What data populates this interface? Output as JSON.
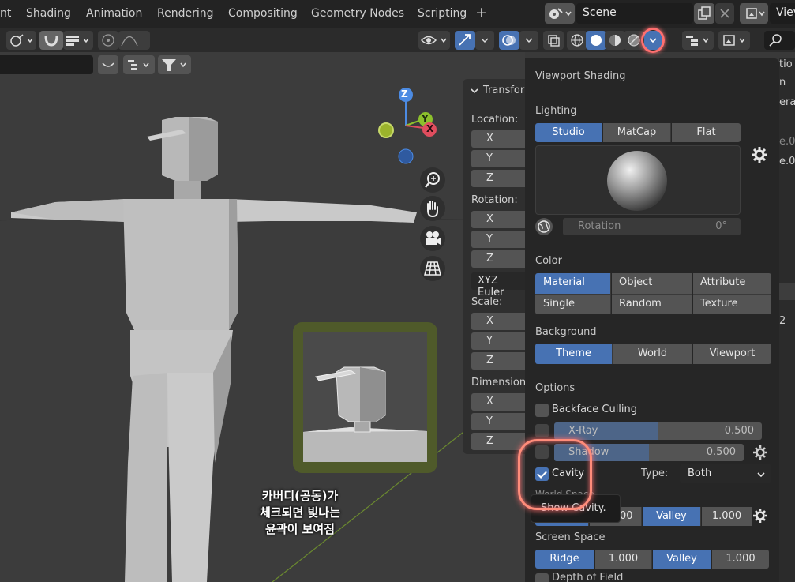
{
  "menubar": {
    "tabs": [
      "nt",
      "Shading",
      "Animation",
      "Rendering",
      "Compositing",
      "Geometry Nodes",
      "Scripting"
    ],
    "add_tab": "+",
    "scene_name": "Scene",
    "view_layer_label": "Viev"
  },
  "npanel": {
    "tab_title": "Transfor",
    "location_label": "Location:",
    "rotation_label": "Rotation:",
    "rotation_mode": "XYZ Euler",
    "scale_label": "Scale:",
    "dimensions_label": "Dimension",
    "axes": [
      "X",
      "Y",
      "Z"
    ]
  },
  "gizmo": {
    "z": "Z",
    "y": "Y",
    "x": "X"
  },
  "annotation": {
    "line1": "카버디(공동)가",
    "line2": "체크되면 빛나는",
    "line3": "윤곽이 보여짐"
  },
  "popover": {
    "title": "Viewport Shading",
    "lighting_label": "Lighting",
    "lighting_options": [
      "Studio",
      "MatCap",
      "Flat"
    ],
    "lighting_selected": "Studio",
    "rotation_label": "Rotation",
    "rotation_value": "0°",
    "color_label": "Color",
    "color_options": [
      "Material",
      "Object",
      "Attribute",
      "Single",
      "Random",
      "Texture"
    ],
    "color_selected": "Material",
    "background_label": "Background",
    "background_options": [
      "Theme",
      "World",
      "Viewport"
    ],
    "background_selected": "Theme",
    "options_label": "Options",
    "backface_culling": {
      "label": "Backface Culling",
      "checked": false
    },
    "xray": {
      "label": "X-Ray",
      "value": "0.500",
      "fraction": 0.5,
      "checked": false
    },
    "shadow": {
      "label": "Shadow",
      "value": "0.500",
      "fraction": 0.5,
      "checked": false
    },
    "cavity": {
      "label": "Cavity",
      "checked": true
    },
    "type_label": "Type:",
    "type_value": "Both",
    "world_space_label": "World Space",
    "tooltip": "Show Cavity.",
    "world_ridge_value": "00",
    "world_valley_label": "Valley",
    "world_valley_value": "1.000",
    "screen_space_label": "Screen Space",
    "screen_ridge_label": "Ridge",
    "screen_ridge_value": "1.000",
    "screen_valley_label": "Valley",
    "screen_valley_value": "1.000",
    "depth_of_field_label": "Depth of Field"
  },
  "rightstrip": {
    "cut_labels": [
      "tio",
      "n",
      "era",
      "e.0",
      "e.0",
      "2"
    ]
  },
  "colors": {
    "accent": "#4772b3",
    "highlight": "#ff6f6f",
    "frame": "#4f5a2a"
  }
}
